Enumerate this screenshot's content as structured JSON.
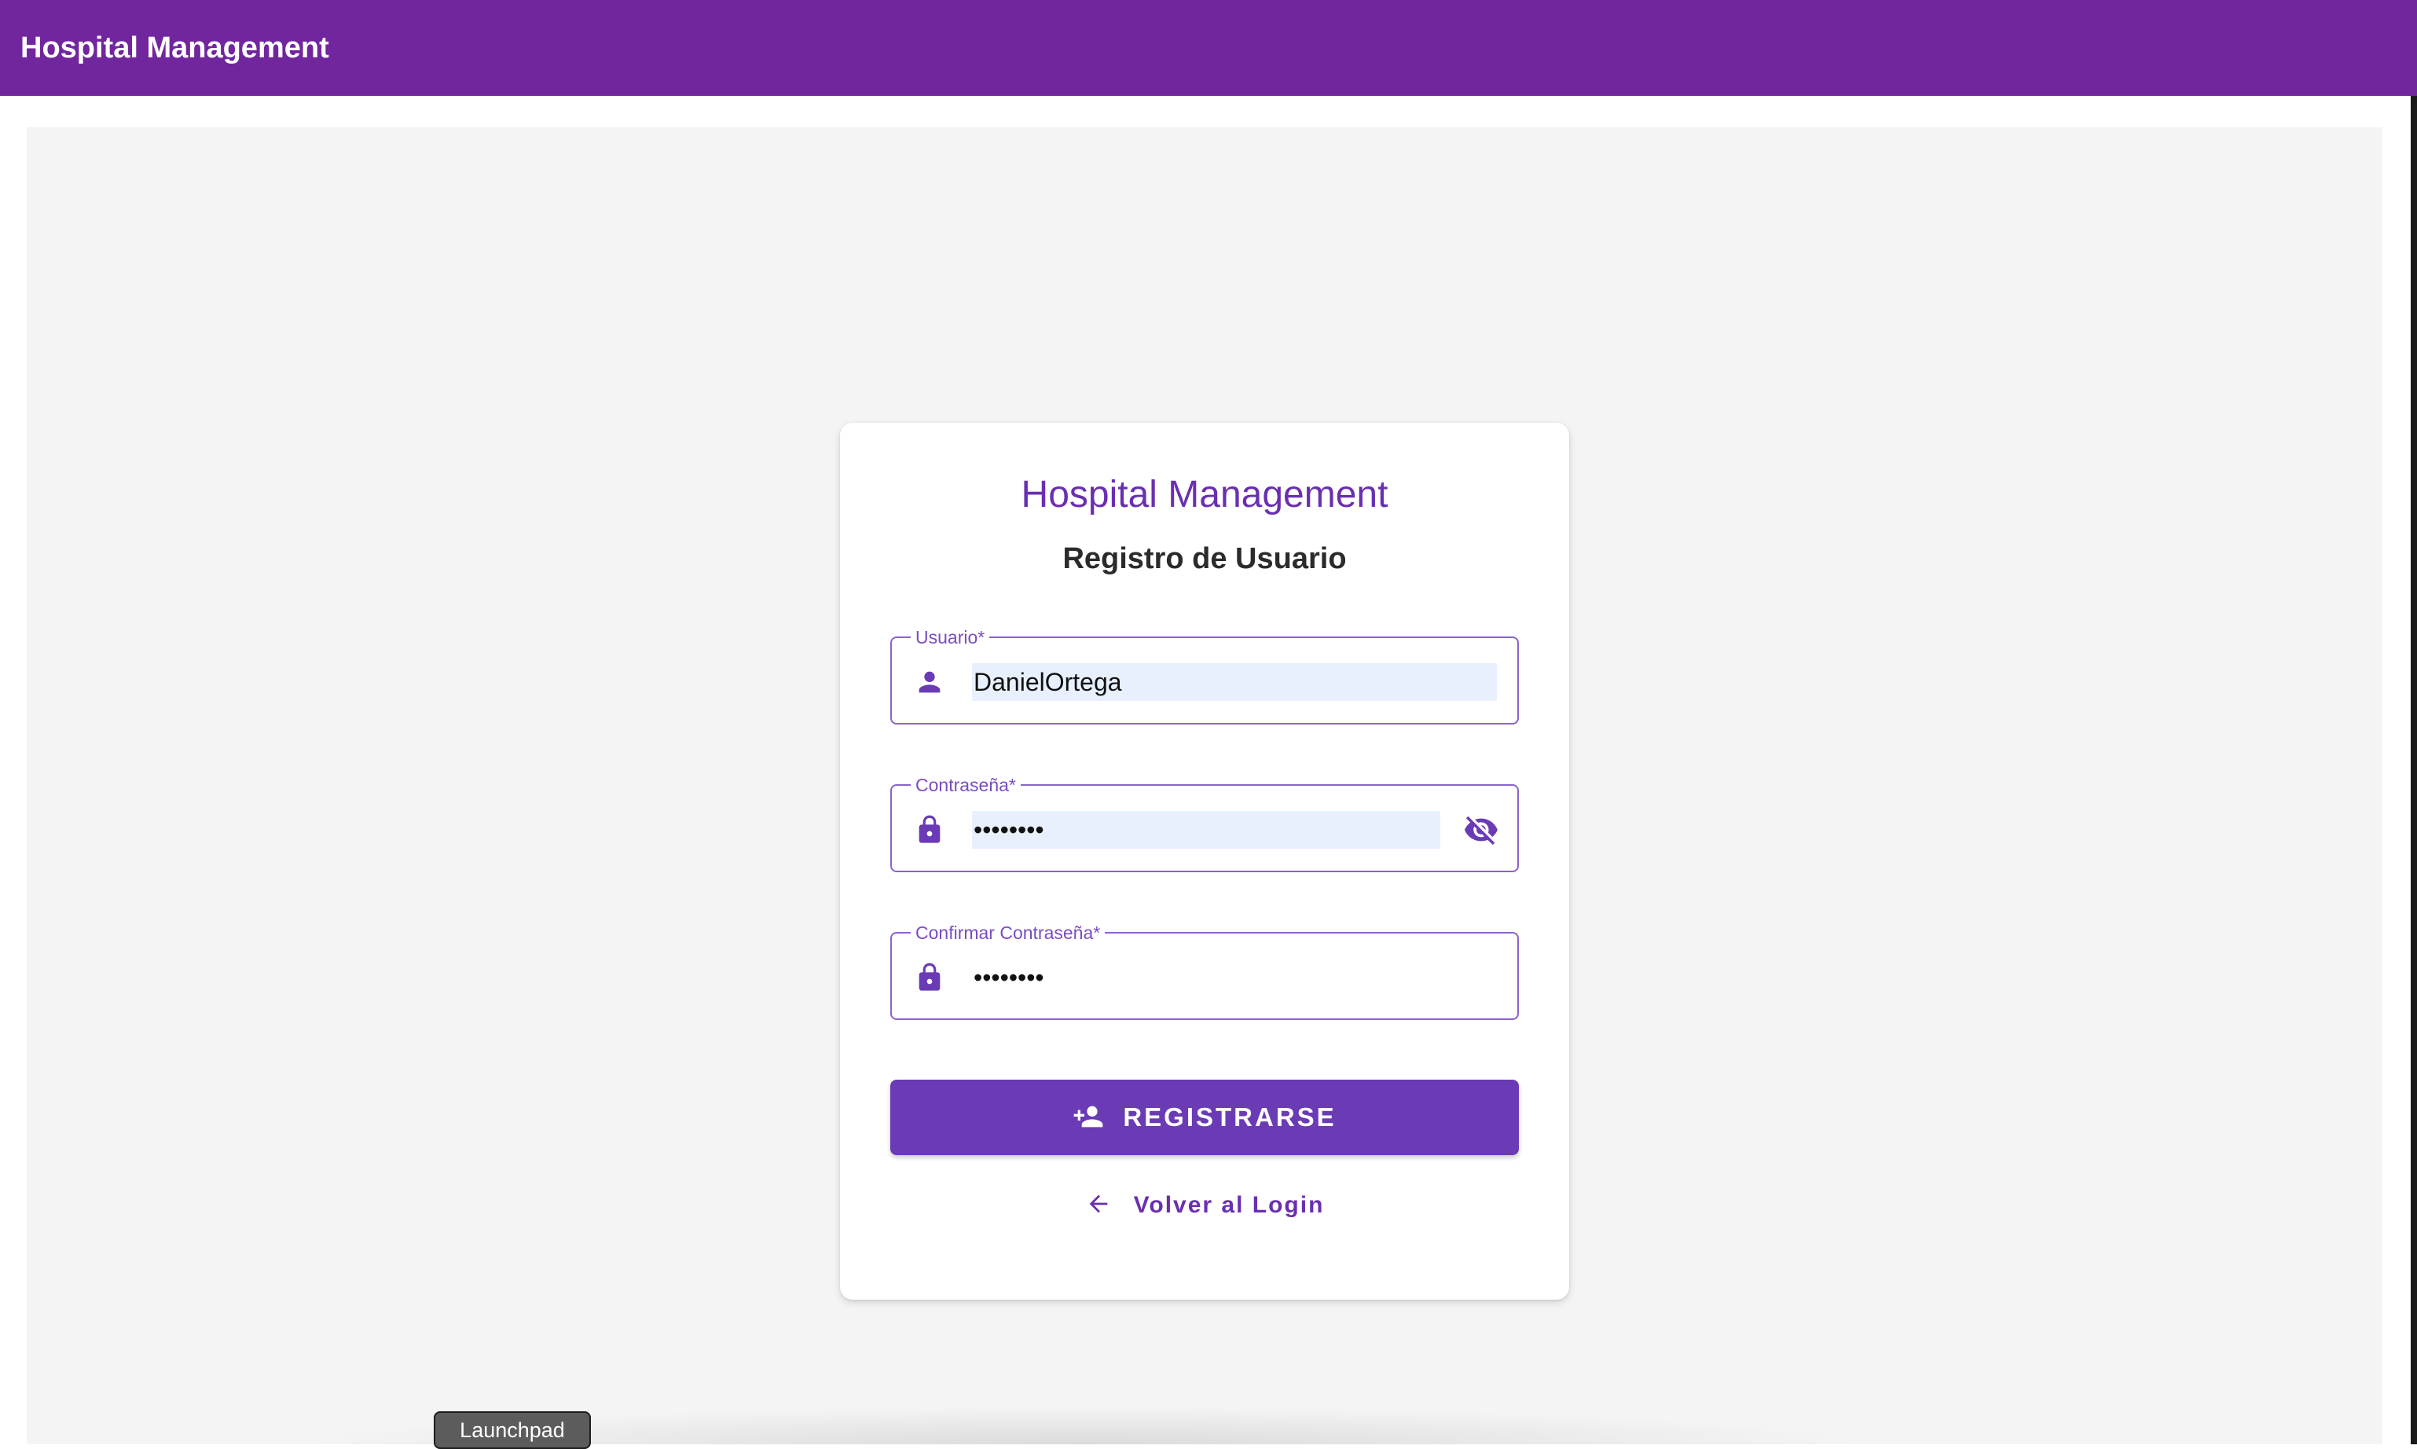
{
  "toolbar": {
    "title": "Hospital Management"
  },
  "card": {
    "title": "Hospital Management",
    "subtitle": "Registro de Usuario"
  },
  "fields": {
    "username": {
      "label": "Usuario*",
      "value": "DanielOrtega",
      "icon": "person-icon"
    },
    "password": {
      "label": "Contraseña*",
      "value": "••••••••",
      "icon": "lock-icon",
      "toggle_icon": "visibility-off-icon"
    },
    "confirm_password": {
      "label": "Confirmar Contraseña*",
      "value": "••••••••",
      "icon": "lock-icon"
    }
  },
  "actions": {
    "register": {
      "label": "REGISTRARSE",
      "icon": "person-add-icon"
    },
    "back": {
      "label": "Volver al Login",
      "icon": "arrow-back-icon"
    }
  },
  "dock": {
    "tooltip": "Launchpad"
  },
  "colors": {
    "toolbar": "#72269e",
    "accent": "#6a3bb5",
    "field_border": "#8a63c9",
    "autofill": "#e8f0fe",
    "stage": "#f4f4f4"
  }
}
